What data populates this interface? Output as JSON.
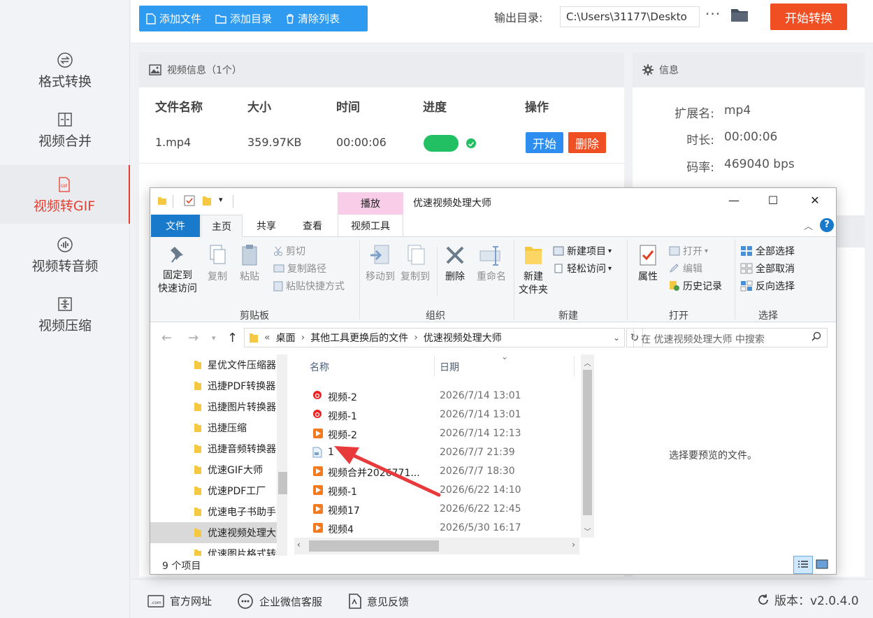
{
  "colors": {
    "accent_blue": "#2e9bf0",
    "accent_red": "#f04e23",
    "progress_green": "#22c063",
    "explorer_file_tab": "#1979ca",
    "context_tab_pink": "#f9cde7"
  },
  "sidebar": {
    "items": [
      {
        "label": "格式转换",
        "icon": "convert-icon"
      },
      {
        "label": "视频合并",
        "icon": "merge-icon"
      },
      {
        "label": "视频转GIF",
        "icon": "gif-icon"
      },
      {
        "label": "视频转音频",
        "icon": "audio-icon"
      },
      {
        "label": "视频压缩",
        "icon": "compress-icon"
      }
    ]
  },
  "toolbar": {
    "add_file": "添加文件",
    "add_dir": "添加目录",
    "clear_list": "清除列表",
    "output_label": "输出目录:",
    "output_path": "C:\\Users\\31177\\Deskto",
    "more": "···",
    "start_convert": "开始转换"
  },
  "video_panel": {
    "title": "视频信息（1个）",
    "columns": [
      "文件名称",
      "大小",
      "时间",
      "进度",
      "操作"
    ],
    "rows": [
      {
        "name": "1.mp4",
        "size": "359.97KB",
        "time": "00:00:06",
        "progress": 1.0,
        "start": "开始",
        "delete": "删除"
      }
    ]
  },
  "info_panel": {
    "title": "信息",
    "fields": [
      {
        "key": "扩展名:",
        "value": "mp4"
      },
      {
        "key": "时长:",
        "value": "00:00:06"
      },
      {
        "key": "码率:",
        "value": "469040 bps"
      }
    ]
  },
  "footer": {
    "website": "官方网址",
    "wechat": "企业微信客服",
    "feedback": "意见反馈",
    "version": "版本：v2.0.4.0"
  },
  "explorer": {
    "context_tab": "播放",
    "title": "优速视频处理大师",
    "tabs": {
      "file": "文件",
      "home": "主页",
      "share": "共享",
      "view": "查看",
      "video_tools": "视频工具"
    },
    "ribbon": {
      "pin": [
        "固定到",
        "快速访问"
      ],
      "copy": "复制",
      "paste": "粘贴",
      "cut": "剪切",
      "copy_path": "复制路径",
      "paste_shortcut": "粘贴快捷方式",
      "clipboard": "剪贴板",
      "move_to": "移动到",
      "copy_to": "复制到",
      "delete": "删除",
      "rename": "重命名",
      "organize": "组织",
      "new_folder": [
        "新建",
        "文件夹"
      ],
      "new_item": "新建项目",
      "easy_access": "轻松访问",
      "new_group": "新建",
      "properties": "属性",
      "open": "打开",
      "edit": "编辑",
      "history": "历史记录",
      "open_group": "打开",
      "select_all": "全部选择",
      "select_none": "全部取消",
      "invert": "反向选择",
      "select_group": "选择"
    },
    "address": [
      "«",
      "桌面",
      "其他工具更换后的文件",
      "优速视频处理大师"
    ],
    "search_placeholder": "在 优速视频处理大师 中搜索",
    "nav_items": [
      "星优文件压缩器",
      "迅捷PDF转换器",
      "迅捷图片转换器",
      "迅捷压缩",
      "迅捷音频转换器",
      "优速GIF大师",
      "优速PDF工厂",
      "优速电子书助手",
      "优速视频处理大师",
      "优速图片格式转换器"
    ],
    "columns": {
      "name": "名称",
      "date": "日期"
    },
    "files": [
      {
        "name": "视频-2",
        "date": "2026/7/14 13:01",
        "icon": "netease-music-icon"
      },
      {
        "name": "视频-1",
        "date": "2026/7/14 13:01",
        "icon": "netease-music-icon"
      },
      {
        "name": "视频-2",
        "date": "2026/7/14 12:13",
        "icon": "video-file-icon"
      },
      {
        "name": "1",
        "date": "2026/7/7 21:39",
        "icon": "generic-file-icon"
      },
      {
        "name": "视频合并2026771...",
        "date": "2026/7/7 18:30",
        "icon": "video-file-icon"
      },
      {
        "name": "视频-1",
        "date": "2026/6/22 14:10",
        "icon": "video-file-icon"
      },
      {
        "name": "视频17",
        "date": "2026/6/22 12:45",
        "icon": "video-file-icon"
      },
      {
        "name": "视频4",
        "date": "2026/5/30 16:17",
        "icon": "video-file-icon"
      }
    ],
    "preview_text": "选择要预览的文件。",
    "item_count": "9 个项目"
  }
}
